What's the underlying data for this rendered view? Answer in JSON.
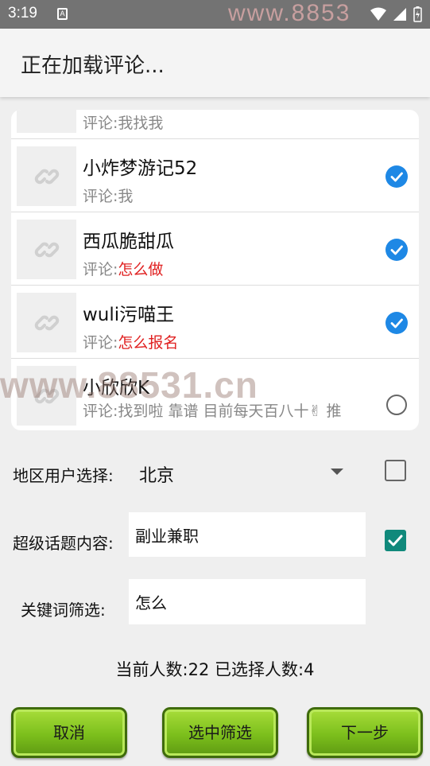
{
  "status": {
    "time": "3:19",
    "badge": "A",
    "watermark": "www.8853"
  },
  "header": {
    "title": "正在加载评论..."
  },
  "comments": [
    {
      "name": "",
      "prefix": "评论:",
      "text": "我找我",
      "highlight": "",
      "checked": null
    },
    {
      "name": "小炸梦游记52",
      "prefix": "评论:",
      "text": "我",
      "highlight": "",
      "checked": true
    },
    {
      "name": "西瓜脆甜瓜",
      "prefix": "评论:",
      "text": "",
      "highlight": "怎么做",
      "checked": true
    },
    {
      "name": "wuli污喵王",
      "prefix": "评论:",
      "text": "",
      "highlight": "怎么报名",
      "checked": true
    },
    {
      "name": "小欣欣K",
      "prefix": "评论:",
      "text": "找到啦 靠谱 目前每天百八十✌ 推",
      "highlight": "",
      "checked": false
    }
  ],
  "watermark_mid": "www.88531.cn",
  "form": {
    "region_label": "地区用户选择:",
    "region_value": "北京",
    "region_checked": false,
    "topic_label": "超级话题内容:",
    "topic_value": "副业兼职",
    "topic_checked": true,
    "keyword_label": "关键词筛选:",
    "keyword_value": "怎么"
  },
  "summary": "当前人数:22 已选择人数:4",
  "buttons": {
    "cancel": "取消",
    "filter": "选中筛选",
    "next": "下一步"
  },
  "colors": {
    "check_blue": "#1e88e5",
    "checkbox_teal": "#10897b",
    "highlight_red": "#e02020",
    "button_green": "#7cbf1c"
  }
}
